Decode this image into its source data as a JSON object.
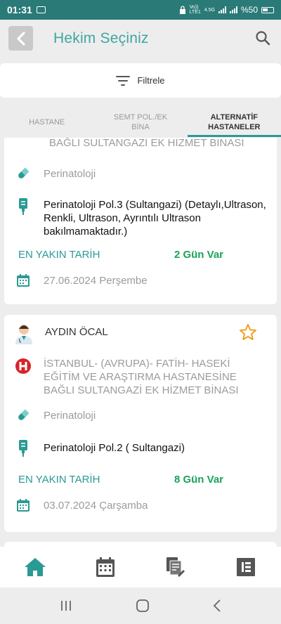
{
  "status": {
    "time": "01:31",
    "network": "Vo))\nLTE1",
    "net_type": "4.5G",
    "battery": "%50"
  },
  "header": {
    "title": "Hekim Seçiniz"
  },
  "filter": {
    "label": "Filtrele"
  },
  "tabs": [
    {
      "label": "HASTANE",
      "active": false
    },
    {
      "label": "SEMT POL./EK\nBİNA",
      "active": false
    },
    {
      "label": "ALTERNATİF\nHASTANELER",
      "active": true
    }
  ],
  "cards": [
    {
      "hospital_tail": "BAĞLI SULTANGAZİ EK HİZMET BİNASI",
      "department": "Perinatoloji",
      "clinic": "Perinatoloji Pol.3 (Sultangazi) (Detaylı,Ultrason, Renkli, Ultrason, Ayrıntılı Ultrason bakılmamaktadır.)",
      "nearest_label": "EN YAKIN TARİH",
      "days": "2 Gün Var",
      "date": "27.06.2024 Perşembe"
    },
    {
      "doctor": "AYDIN ÖCAL",
      "hospital": "İSTANBUL- (AVRUPA)- FATİH- HASEKİ EĞİTİM VE ARAŞTIRMA HASTANESİNE BAĞLI SULTANGAZİ EK HİZMET BİNASI",
      "department": "Perinatoloji",
      "clinic": "Perinatoloji Pol.2 ( Sultangazi)",
      "nearest_label": "EN YAKIN TARİH",
      "days": "8 Gün Var",
      "date": "03.07.2024 Çarşamba"
    }
  ],
  "colors": {
    "teal": "#2a9a94",
    "green": "#1aa35a",
    "star": "#f0a020",
    "hospital_red": "#d8232a",
    "statusbar": "#2a7a78"
  },
  "bottom_nav": [
    "home-icon",
    "calendar-icon",
    "documents-icon",
    "list-icon"
  ]
}
